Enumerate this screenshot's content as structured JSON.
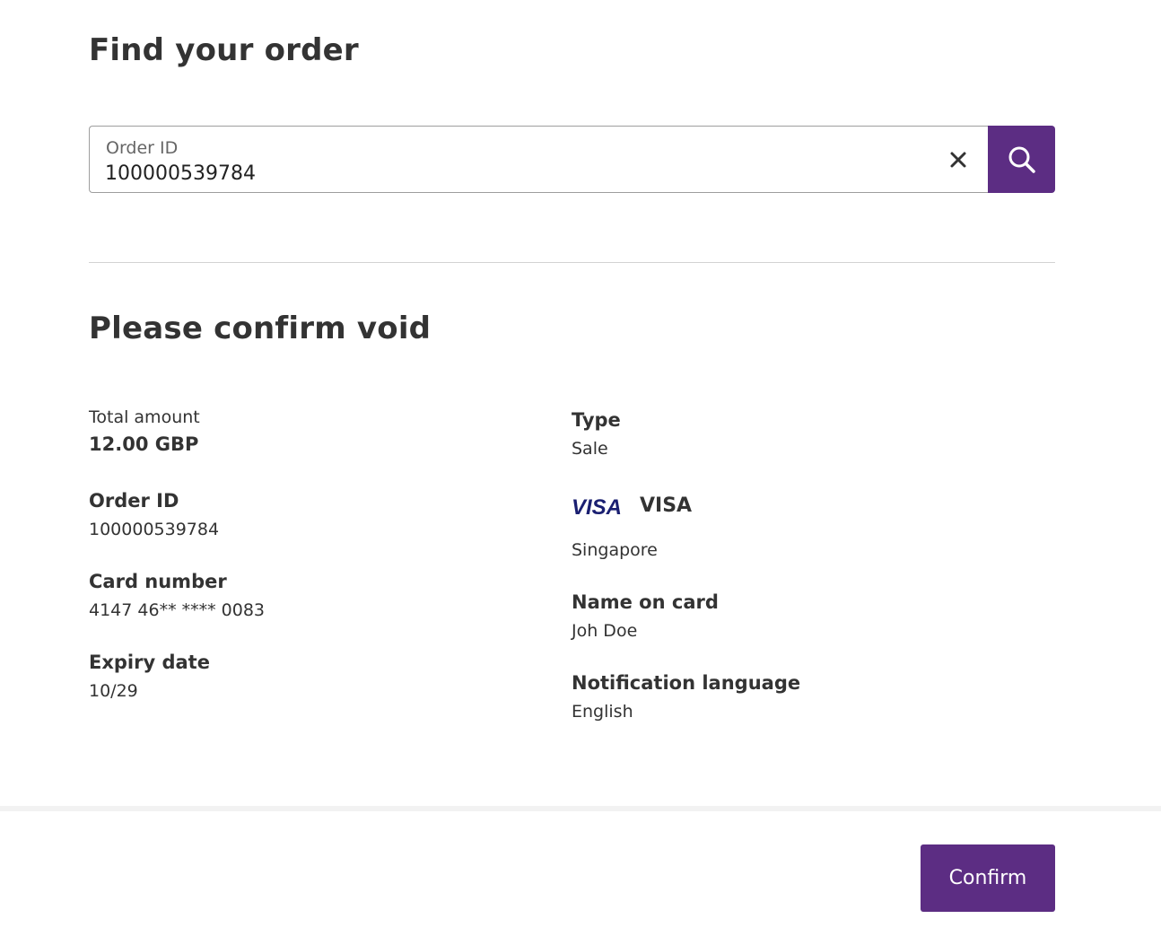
{
  "find": {
    "title": "Find your order",
    "field_label": "Order ID",
    "field_value": "100000539784",
    "clear_icon": "close-icon",
    "search_icon": "search-icon"
  },
  "confirm": {
    "title": "Please confirm void",
    "left": [
      {
        "label": "Total amount",
        "value": "12.00 GBP"
      },
      {
        "label": "Order ID",
        "value": "100000539784"
      },
      {
        "label": "Card number",
        "value": "4147 46** **** 0083"
      },
      {
        "label": "Expiry date",
        "value": "10/29"
      }
    ],
    "right": {
      "type_label": "Type",
      "type_value": "Sale",
      "card_brand_logo": "VISA",
      "card_brand": "VISA",
      "country": "Singapore",
      "name_label": "Name on card",
      "name_value": "Joh Doe",
      "lang_label": "Notification language",
      "lang_value": "English"
    }
  },
  "footer": {
    "confirm_label": "Confirm"
  },
  "colors": {
    "accent": "#5c2d83",
    "visa_blue": "#1a1f71"
  }
}
